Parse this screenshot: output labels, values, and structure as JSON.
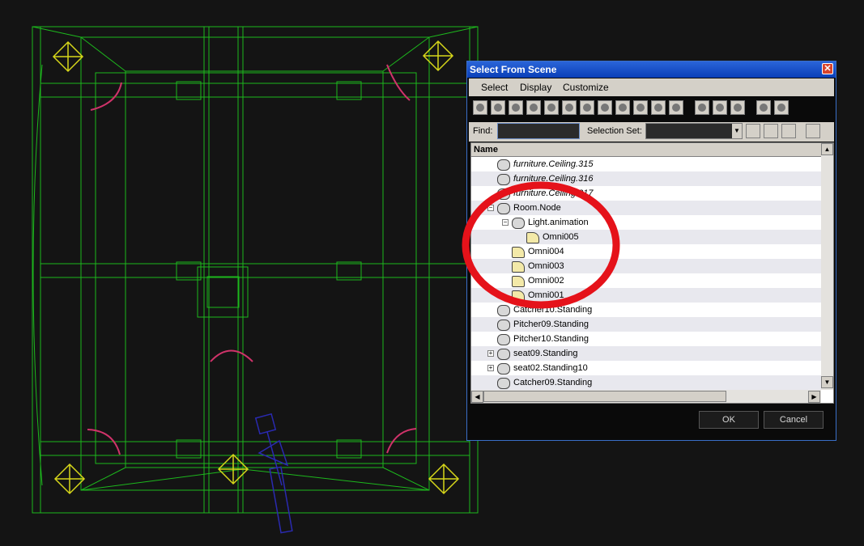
{
  "dialog": {
    "title": "Select From Scene",
    "close_glyph": "✕",
    "menu": [
      "Select",
      "Display",
      "Customize"
    ],
    "toolbar_icons": [
      "sphere-icon",
      "geometry-icon",
      "light-icon",
      "camera-icon",
      "helper-icon",
      "spacewarp-icon",
      "group-icon",
      "xref-icon",
      "bone-icon",
      "container-icon",
      "frozen-icon",
      "hidden-icon",
      "list-all-icon",
      "list-none-icon",
      "list-invert-icon",
      "filter-icon",
      "filter-options-icon"
    ],
    "find_label": "Find:",
    "selection_set_label": "Selection Set:",
    "column_name": "Name",
    "rows": [
      {
        "name": "furniture.Ceiling.315",
        "indent": 0,
        "italic": true,
        "icon": "helper-icon",
        "expander": ""
      },
      {
        "name": "furniture.Ceiling.316",
        "indent": 0,
        "italic": true,
        "icon": "helper-icon",
        "expander": ""
      },
      {
        "name": "furniture.Ceiling.317",
        "indent": 0,
        "italic": true,
        "icon": "helper-icon",
        "expander": ""
      },
      {
        "name": "Room.Node",
        "indent": 0,
        "italic": false,
        "icon": "helper-icon",
        "expander": "−"
      },
      {
        "name": "Light.animation",
        "indent": 1,
        "italic": false,
        "icon": "helper-icon",
        "expander": "−"
      },
      {
        "name": "Omni005",
        "indent": 2,
        "italic": false,
        "icon": "light-icon",
        "expander": ""
      },
      {
        "name": "Omni004",
        "indent": 1,
        "italic": false,
        "icon": "light-icon",
        "expander": ""
      },
      {
        "name": "Omni003",
        "indent": 1,
        "italic": false,
        "icon": "light-icon",
        "expander": ""
      },
      {
        "name": "Omni002",
        "indent": 1,
        "italic": false,
        "icon": "light-icon",
        "expander": ""
      },
      {
        "name": "Omni001",
        "indent": 1,
        "italic": false,
        "icon": "light-icon",
        "expander": ""
      },
      {
        "name": "Catcher10.Standing",
        "indent": 0,
        "italic": false,
        "icon": "helper-icon",
        "expander": ""
      },
      {
        "name": "Pitcher09.Standing",
        "indent": 0,
        "italic": false,
        "icon": "helper-icon",
        "expander": ""
      },
      {
        "name": "Pitcher10.Standing",
        "indent": 0,
        "italic": false,
        "icon": "helper-icon",
        "expander": ""
      },
      {
        "name": "seat09.Standing",
        "indent": 0,
        "italic": false,
        "icon": "helper-icon",
        "expander": "+"
      },
      {
        "name": "seat02.Standing10",
        "indent": 0,
        "italic": false,
        "icon": "helper-icon",
        "expander": "+"
      },
      {
        "name": "Catcher09.Standing",
        "indent": 0,
        "italic": false,
        "icon": "helper-icon",
        "expander": ""
      }
    ],
    "ok_label": "OK",
    "cancel_label": "Cancel"
  },
  "colors": {
    "wireframe": "#1db81d",
    "light_marker": "#d6d61a",
    "spline": "#d0336a",
    "camera": "#2a2ab0",
    "highlight_circle": "#e5121a",
    "viewport_bg": "#141414"
  }
}
